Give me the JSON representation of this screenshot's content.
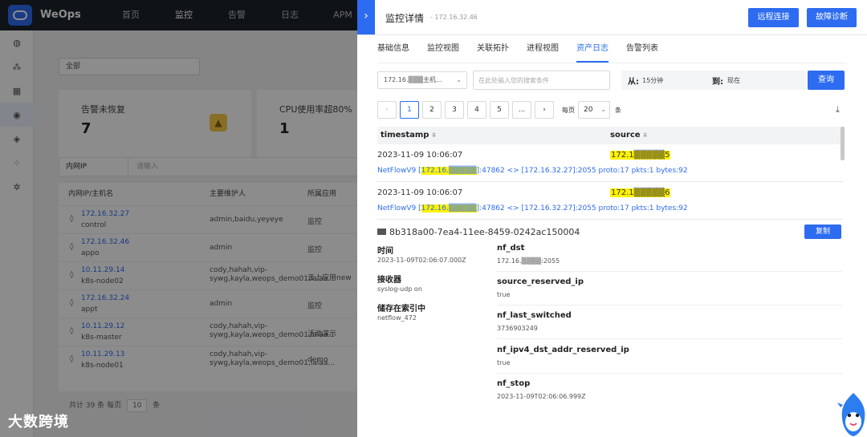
{
  "app": {
    "brand": "WeOps",
    "nav": [
      "首页",
      "监控",
      "告警",
      "日志",
      "APM"
    ],
    "active_nav": "监控",
    "watermark": "大数跨境",
    "side_icons": [
      "dashboard-icon",
      "topology-icon",
      "apps-icon",
      "monitor-icon",
      "alert-icon",
      "cluster-icon",
      "settings-icon"
    ]
  },
  "background": {
    "scope_select": "全部",
    "cards": [
      {
        "label": "告警未恢复",
        "value": "7"
      },
      {
        "label": "CPU使用率超80%",
        "value": "1"
      }
    ],
    "filter_key": "内网IP",
    "filter_placeholder": "请输入",
    "columns": [
      "内网IP/主机名",
      "主要维护人",
      "所属应用"
    ],
    "rows": [
      {
        "ip": "172.16.32.27",
        "host": "control",
        "owner": "admin,baidu,yeyeye",
        "app": "监控"
      },
      {
        "ip": "172.16.32.46",
        "host": "appo",
        "owner": "admin",
        "app": "监控"
      },
      {
        "ip": "10.11.29.14",
        "host": "k8s-node02",
        "owner": "cody,hahah,vip-sywg,kayla,weops_demo01,lalaa...",
        "app": "云上应用new"
      },
      {
        "ip": "172.16.32.24",
        "host": "appt",
        "owner": "admin",
        "app": "监控"
      },
      {
        "ip": "10.11.29.12",
        "host": "k8s-master",
        "owner": "cody,hahah,vip-sywg,kayla,weops_demo01,lalaa...",
        "app": "活动演示"
      },
      {
        "ip": "10.11.29.13",
        "host": "k8s-node01",
        "owner": "cody,hahah,vip-sywg,kayla,weops_demo01,lalaa...",
        "app": "demo"
      }
    ],
    "pager": {
      "total": "共计 39 条",
      "per": "每页",
      "size": "10",
      "unit": "条"
    }
  },
  "drawer": {
    "title": "监控详情",
    "subtitle": "- 172.16.32.46",
    "btn_remote": "远程连接",
    "btn_diag": "故障诊断",
    "tabs": [
      "基础信息",
      "监控视图",
      "关联拓扑",
      "进程视图",
      "资产日志",
      "告警列表"
    ],
    "active_tab": "资产日志",
    "ip_select": "172.16.▒▒▒主机...",
    "search_placeholder": "在此处输入您的搜索条件",
    "from_label": "从:",
    "from_value": "15分钟",
    "to_label": "到:",
    "to_value": "现在",
    "query_btn": "查询",
    "pages": [
      "1",
      "2",
      "3",
      "4",
      "5",
      "..."
    ],
    "prev": "‹",
    "next": "›",
    "per_page_label": "每页",
    "per_page": "20",
    "unit": "条",
    "table": {
      "col1": "timestamp",
      "col2": "source",
      "rows": [
        {
          "timestamp": "2023-11-09 10:06:07",
          "source": "172.1▒▒▒▒▒5",
          "msg_pre": "NetFlowV9 [",
          "msg_hl": "172.16.▒▒▒▒▒",
          "msg_post": "]:47862 <> [172.16.32.27]:2055 proto:17 pkts:1 bytes:92"
        },
        {
          "timestamp": "2023-11-09 10:06:07",
          "source": "172.1▒▒▒▒▒6",
          "msg_pre": "NetFlowV9 [",
          "msg_hl": "172.16.▒▒▒▒▒",
          "msg_post": "]:47862 <> [172.16.32.27]:2055 proto:17 pkts:1 bytes:92"
        }
      ]
    },
    "detail": {
      "id": "8b318a00-7ea4-11ee-8459-0242ac150004",
      "copy_btn": "复制",
      "time_label": "时间",
      "time_value": "2023-11-09T02:06:07.000Z",
      "receiver_label": "接收器",
      "receiver_value": "syslog-udp on",
      "index_label": "储存在索引中",
      "index_value": "netflow_472",
      "fields": [
        {
          "key": "nf_dst",
          "value": "172.16.▒▒▒▒:2055"
        },
        {
          "key": "source_reserved_ip",
          "value": "true"
        },
        {
          "key": "nf_last_switched",
          "value": "3736903249"
        },
        {
          "key": "nf_ipv4_dst_addr_reserved_ip",
          "value": "true"
        },
        {
          "key": "nf_stop",
          "value": "2023-11-09T02:06:06.999Z"
        }
      ]
    }
  },
  "colors": {
    "primary": "#2d6cf0",
    "highlight": "#fff200",
    "topbar": "#1d2129"
  }
}
